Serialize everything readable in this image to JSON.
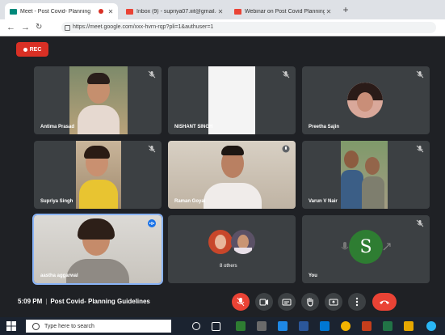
{
  "browser": {
    "tabs": [
      {
        "title": "Meet - Post Covid- Planning",
        "recording": true,
        "active": true,
        "favicon_color": "#00897b"
      },
      {
        "title": "Inbox (9) - supriya07.iiit@gmail.c",
        "recording": false,
        "active": false,
        "favicon_color": "#ea4335"
      },
      {
        "title": "Webinar on Post Covid Planning",
        "recording": false,
        "active": false,
        "favicon_color": "#ea4335"
      }
    ],
    "new_tab": "+",
    "url": "https://meet.google.com/xxx-hvrn-rqp?pli=1&authuser=1"
  },
  "meet": {
    "rec_label": "REC",
    "participants": [
      {
        "name": "Antima Prasad",
        "speaking": false
      },
      {
        "name": "NISHANT SINGH",
        "speaking": false
      },
      {
        "name": "Preetha Sajin",
        "speaking": false
      },
      {
        "name": "Supriya Singh",
        "speaking": false
      },
      {
        "name": "Raman Goyal",
        "speaking": false
      },
      {
        "name": "Varun V Nair",
        "speaking": false
      },
      {
        "name": "aastha aggarwal",
        "speaking": true
      },
      {
        "name": "8 others",
        "speaking": false
      },
      {
        "name": "You",
        "speaking": false
      }
    ],
    "time": "5:09 PM",
    "meeting_title": "Post Covid- Planning Guidelines",
    "controls": [
      "mic-off",
      "camera",
      "captions",
      "raise-hand",
      "present",
      "more",
      "end-call"
    ]
  },
  "taskbar": {
    "search_placeholder": "Type here to search"
  },
  "colors": {
    "meet_bg": "#1f2125",
    "tile_bg": "#3c4043",
    "accent_red": "#ea4335",
    "speaking_outline": "#8ab4f8"
  }
}
